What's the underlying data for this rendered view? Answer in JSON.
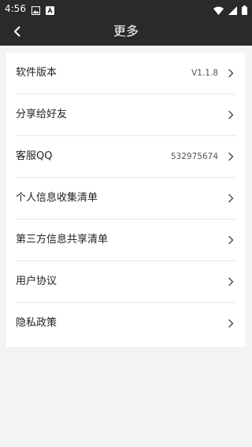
{
  "status_bar": {
    "time": "4:56",
    "icons_left": [
      "image-icon",
      "app-icon"
    ],
    "icons_right": [
      "wifi-icon",
      "signal-icon",
      "battery-icon"
    ]
  },
  "header": {
    "title": "更多",
    "background": "#2a2a2a"
  },
  "menu": {
    "items": [
      {
        "label": "软件版本",
        "value": "V1.1.8"
      },
      {
        "label": "分享给好友",
        "value": ""
      },
      {
        "label": "客服QQ",
        "value": "532975674"
      },
      {
        "label": "个人信息收集清单",
        "value": ""
      },
      {
        "label": "第三方信息共享清单",
        "value": ""
      },
      {
        "label": "用户协议",
        "value": ""
      },
      {
        "label": "隐私政策",
        "value": ""
      }
    ]
  }
}
